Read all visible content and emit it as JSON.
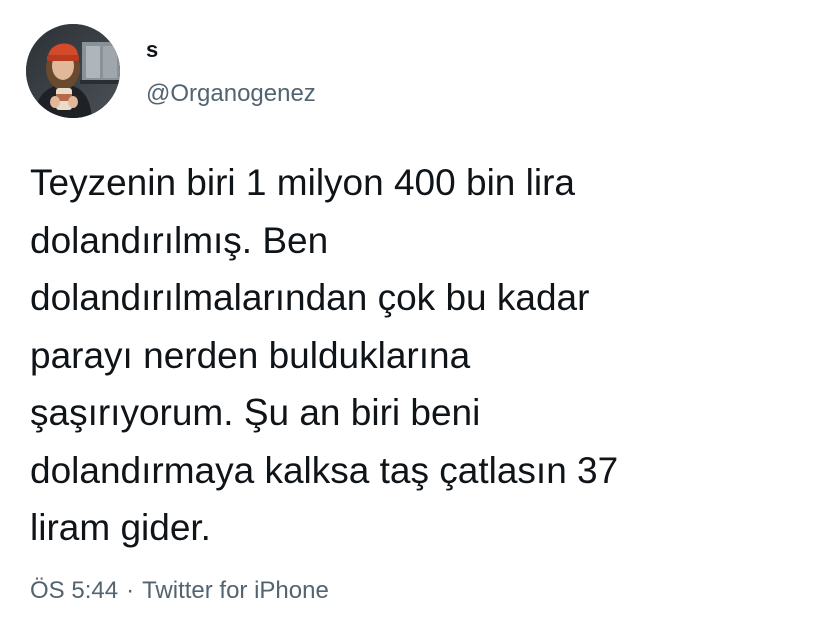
{
  "author": {
    "display_name": "s",
    "handle": "@Organogenez",
    "avatar": "profile-photo"
  },
  "tweet": {
    "text": "Teyzenin biri 1 milyon 400 bin lira\ndolandırılmış. Ben\ndolandırılmalarından çok bu kadar\nparayı nerden bulduklarına\nşaşırıyorum. Şu an biri beni\ndolandırmaya kalksa taş çatlasın 37\nliram gider."
  },
  "meta": {
    "time": "ÖS 5:44",
    "separator": "·",
    "source": "Twitter for iPhone"
  },
  "colors": {
    "text": "#0f1419",
    "secondary": "#536471",
    "background": "#ffffff"
  }
}
